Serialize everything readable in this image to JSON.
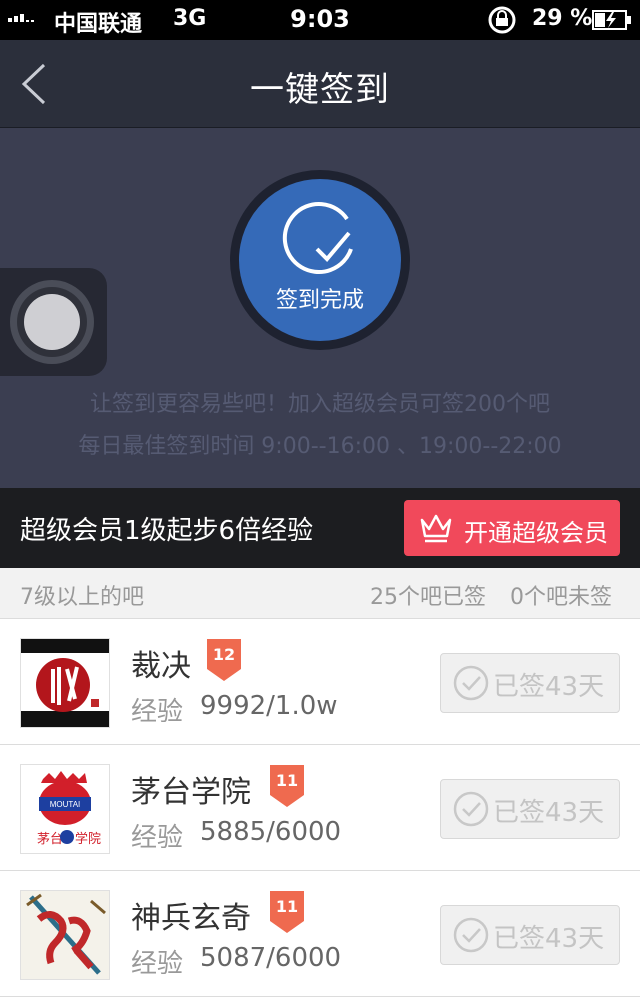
{
  "status": {
    "carrier": "中国联通",
    "network": "3G",
    "time": "9:03",
    "battery": "29 %",
    "icons": [
      "signal-icon",
      "rotation-lock-icon",
      "battery-icon"
    ]
  },
  "nav": {
    "title": "一键签到",
    "back_icon": "chevron-left-icon"
  },
  "sign": {
    "status": "签到完成",
    "tip1": "让签到更容易些吧！加入超级会员可签200个吧",
    "tip2": "每日最佳签到时间  9:00--16:00 、19:00--22:00"
  },
  "member": {
    "text": "超级会员1级起步6倍经验",
    "button": "开通超级会员"
  },
  "section": {
    "left": "7级以上的吧",
    "signed": "25个吧已签",
    "unsigned": "0个吧未签"
  },
  "bars": [
    {
      "name": "裁决",
      "level": "12",
      "exp_label": "经验",
      "exp": "9992/1.0w",
      "status": "已签43天"
    },
    {
      "name": "茅台学院",
      "level": "11",
      "exp_label": "经验",
      "exp": "5885/6000",
      "status": "已签43天"
    },
    {
      "name": "神兵玄奇",
      "level": "11",
      "exp_label": "经验",
      "exp": "5087/6000",
      "status": "已签43天"
    }
  ],
  "colors": {
    "accent_blue": "#356ab8",
    "badge_red": "#f1495b",
    "level_badge": "#ef6a4f"
  }
}
